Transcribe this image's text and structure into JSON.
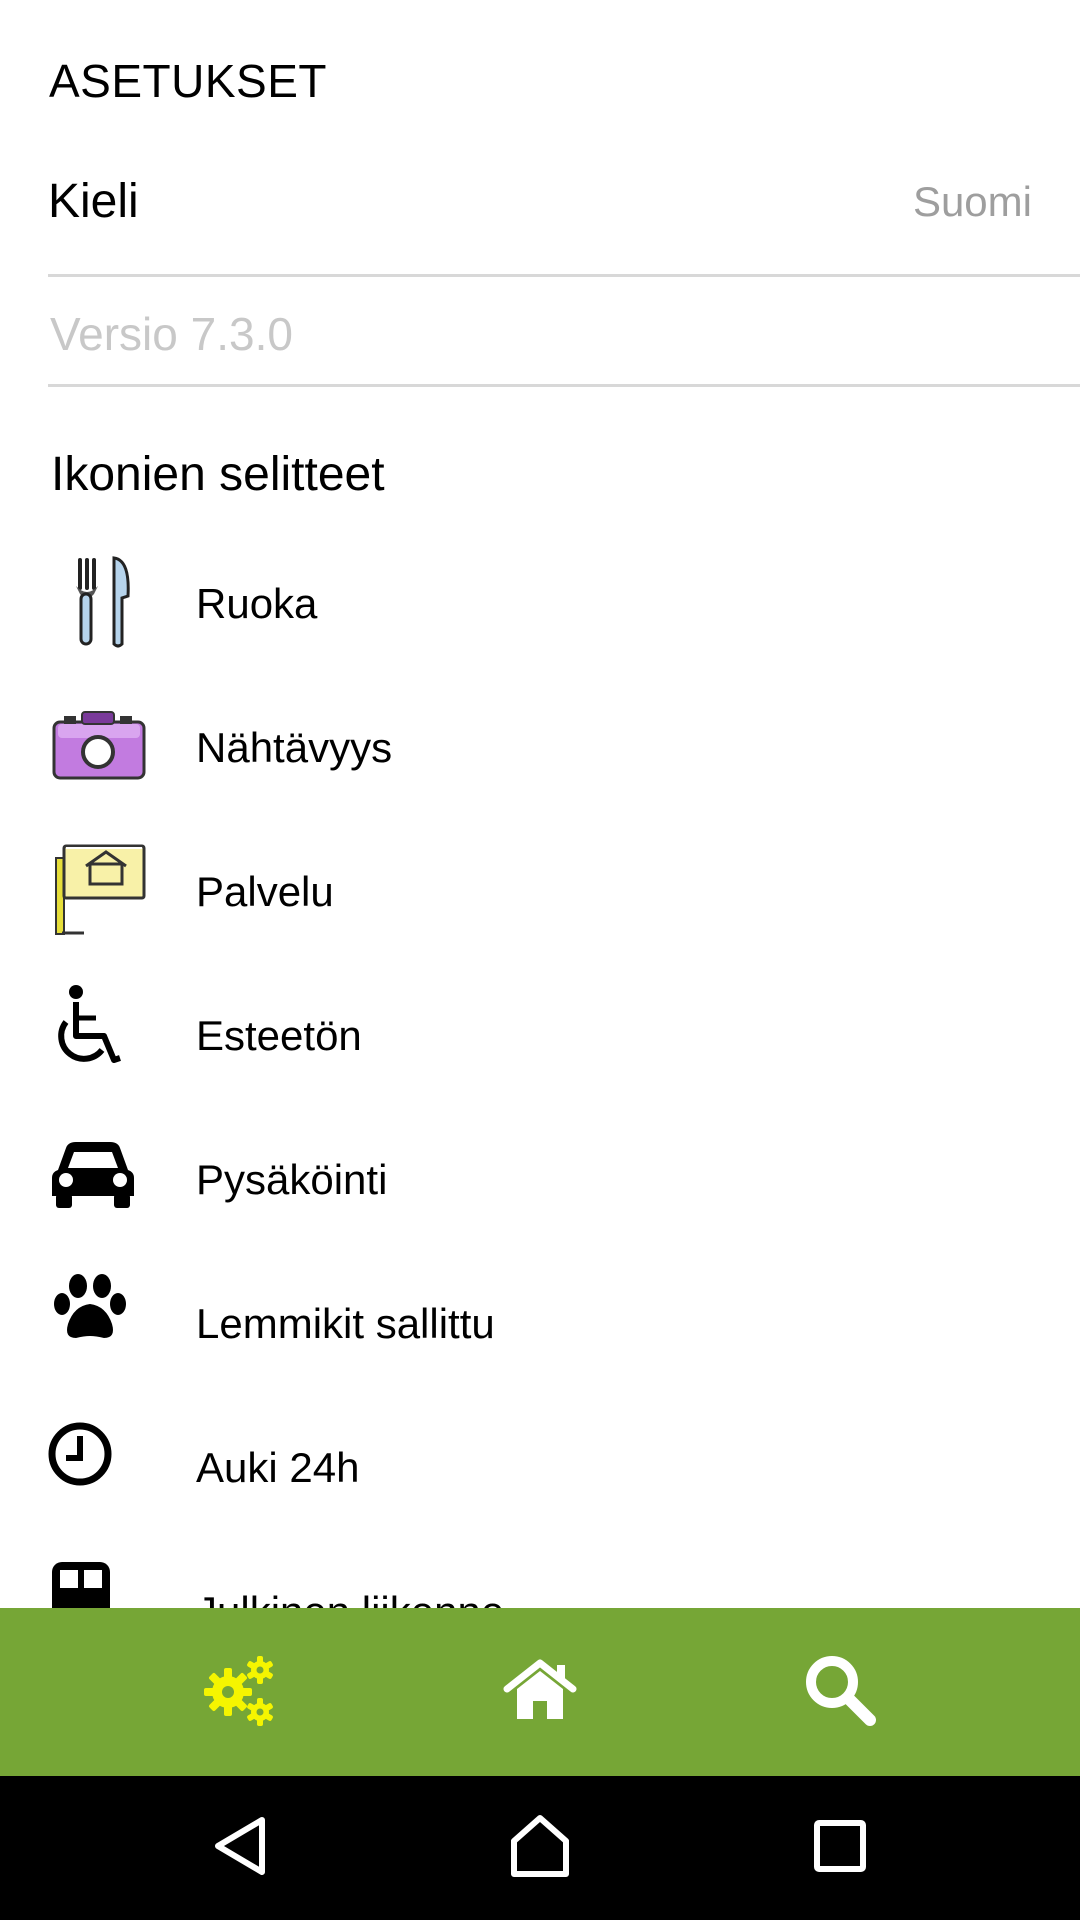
{
  "page": {
    "title": "ASETUKSET"
  },
  "settings": {
    "language_label": "Kieli",
    "language_value": "Suomi",
    "version_label": "Versio 7.3.0"
  },
  "legend": {
    "title": "Ikonien selitteet",
    "items": [
      {
        "label": "Ruoka",
        "icon": "cutlery-icon"
      },
      {
        "label": "Nähtävyys",
        "icon": "camera-icon"
      },
      {
        "label": "Palvelu",
        "icon": "service-sign-icon"
      },
      {
        "label": "Esteetön",
        "icon": "wheelchair-icon"
      },
      {
        "label": "Pysäköinti",
        "icon": "car-icon"
      },
      {
        "label": "Lemmikit sallittu",
        "icon": "paw-icon"
      },
      {
        "label": "Auki 24h",
        "icon": "clock-icon"
      },
      {
        "label": "Julkinen liikenne",
        "icon": "bus-icon"
      }
    ]
  },
  "bottom_nav": {
    "active": "settings",
    "items": [
      {
        "id": "settings",
        "icon": "gears-icon"
      },
      {
        "id": "home",
        "icon": "home-icon"
      },
      {
        "id": "search",
        "icon": "search-icon"
      }
    ]
  },
  "colors": {
    "nav_background": "#76a636",
    "active_icon": "#f5f500",
    "inactive_icon": "#ffffff",
    "divider": "#d8d8d8",
    "secondary_text": "#9e9e9e"
  }
}
